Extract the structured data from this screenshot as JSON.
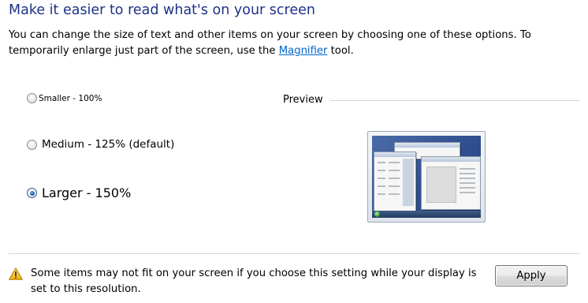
{
  "heading": "Make it easier to read what's on your screen",
  "description": {
    "text_before": "You can change the size of text and other items on your screen by choosing one of these options. To",
    "text_line2_before": "temporarily enlarge just part of the screen, use the ",
    "link": "Magnifier",
    "text_after": " tool."
  },
  "options": [
    {
      "label": "Smaller - 100%",
      "checked": false
    },
    {
      "label": "Medium - 125% (default)",
      "checked": false
    },
    {
      "label": "Larger - 150%",
      "checked": true
    }
  ],
  "preview": {
    "label": "Preview"
  },
  "warning": {
    "icon": "warning-icon",
    "text": "Some items may not fit on your screen if you choose this setting while your display is set to this resolution."
  },
  "apply_button": "Apply",
  "colors": {
    "heading": "#1e3287",
    "link": "#0066cc",
    "desktop": "#3a5a98"
  }
}
